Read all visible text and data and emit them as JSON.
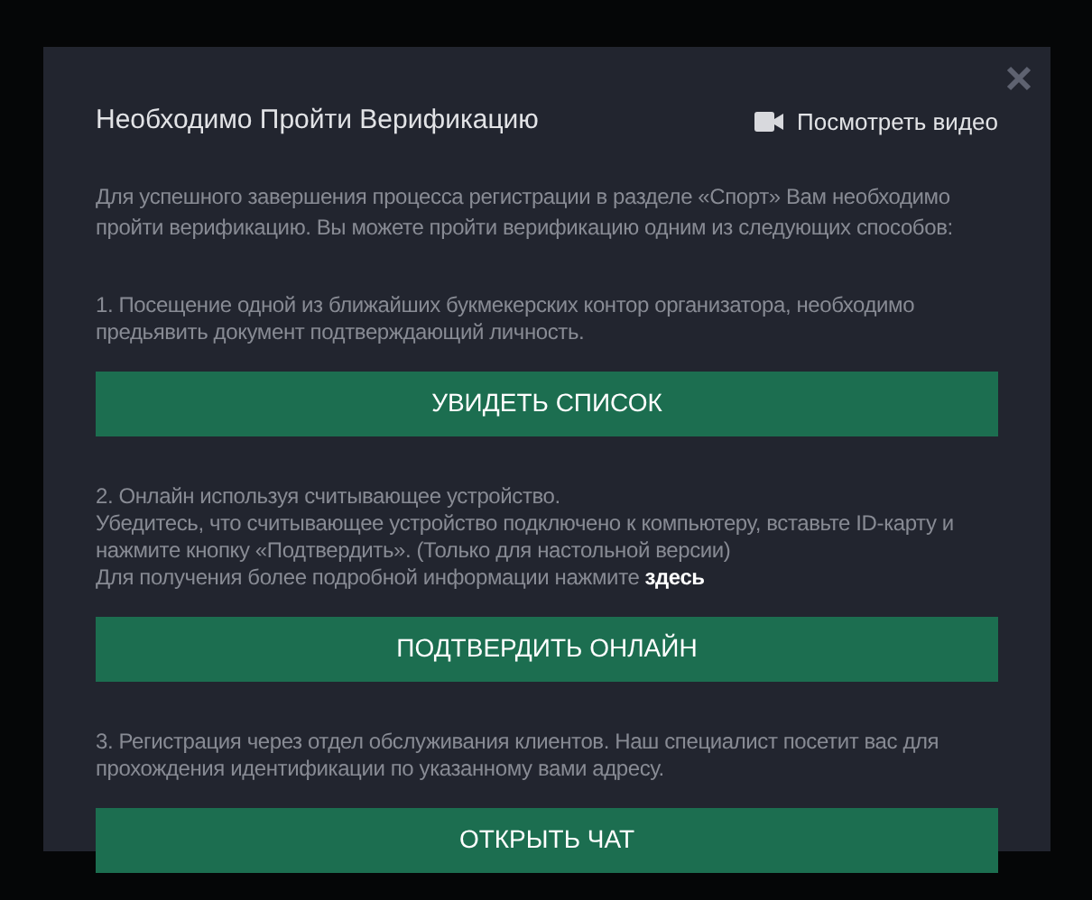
{
  "dialog": {
    "title": "Необходимо Пройти Верификацию",
    "video_link": "Посмотреть видео",
    "intro": "Для успешного завершения процесса регистрации в разделе «Спорт» Вам необходимо пройти верификацию. Вы можете пройти верификацию одним из следующих способов:",
    "sections": [
      {
        "paragraphs": [
          "1. Посещение одной из ближайших букмекерских контор организатора, необходимо предьявить документ подтверждающий личность."
        ],
        "button": "УВИДЕТЬ СПИСОК"
      },
      {
        "paragraphs": [
          "2. Онлайн используя считывающее устройство.",
          "Убедитесь, что считывающее устройство подключено к компьютеру, вставьте ID-карту и нажмите кнопку «Подтвердить». (Только для настольной версии)",
          "Для получения более подробной информации нажмите"
        ],
        "link": "здесь",
        "button": "ПОДТВЕРДИТЬ ОНЛАЙН"
      },
      {
        "paragraphs": [
          "3. Регистрация через отдел обслуживания клиентов. Наш специалист посетит вас для прохождения идентификации по указанному вами адресу."
        ],
        "button": "ОТКРЫТЬ ЧАТ"
      }
    ]
  }
}
